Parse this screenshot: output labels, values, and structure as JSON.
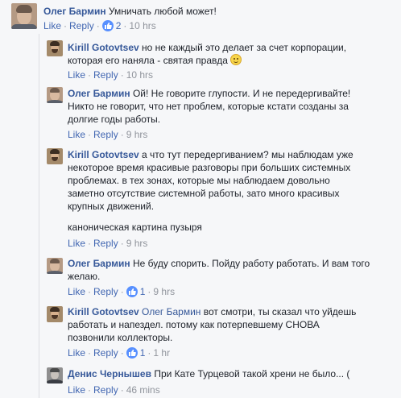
{
  "actions": {
    "like": "Like",
    "reply": "Reply",
    "sep": "·"
  },
  "comments": [
    {
      "author": "Олег Бармин",
      "text": "Умничать любой может!",
      "likes": "2",
      "time": "10 hrs"
    },
    {
      "author": "Kirill Gotovtsev",
      "text_line1": "но не каждый это делает за счет корпорации,",
      "text_line2": "которая его наняла - святая правда",
      "time": "10 hrs"
    },
    {
      "author": "Олег Бармин",
      "text_line1": "Ой! Не говорите глупости. И не передергивайте!",
      "text_line2": "Никто не говорит, что нет проблем, которые кстати созданы за",
      "text_line3": "долгие годы работы.",
      "time": "9 hrs"
    },
    {
      "author": "Kirill Gotovtsev",
      "text_line1": "а что тут передергиванием? мы наблюдам уже",
      "text_line2": "некоторое время красивые разговоры при больших системных",
      "text_line3": "проблемах. в тех зонах, которые мы наблюдаем довольно",
      "text_line4": "заметно отсутствие системной работы, зато много красивых",
      "text_line5": "крупных движений.",
      "text_line6": "каноническая картина пузыря",
      "time": "9 hrs"
    },
    {
      "author": "Олег Бармин",
      "text_line1": "Не буду спорить. Пойду работу работать. И вам того",
      "text_line2": "желаю.",
      "likes": "1",
      "time": "9 hrs"
    },
    {
      "author": "Kirill Gotovtsev",
      "mention": "Олег Бармин",
      "text_line1": "вот смотри, ты сказал что уйдешь",
      "text_line2": "работать и напездел. потому как потерпевшему СНОВА",
      "text_line3": "позвонили коллекторы.",
      "likes": "1",
      "time": "1 hr"
    },
    {
      "author": "Денис Чернышев",
      "text_line1": "При Кате Турцевой такой хрени не было... (",
      "time": "46 mins"
    }
  ]
}
